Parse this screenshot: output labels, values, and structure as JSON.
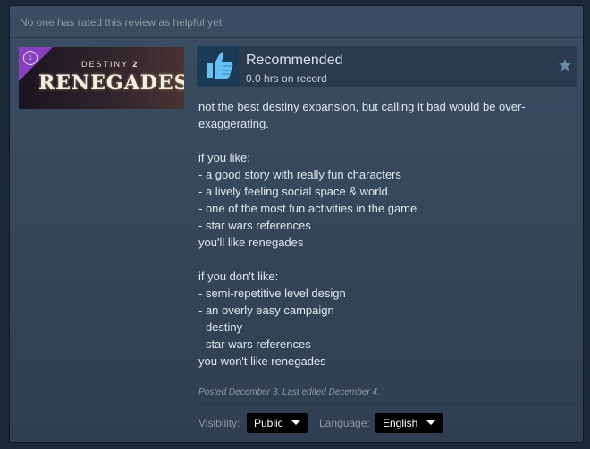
{
  "helpful_text": "No one has rated this review as helpful yet",
  "game": {
    "subtitle_prefix": "DESTINY",
    "subtitle_suffix": "2",
    "title": "RENEGADES",
    "badge_icon": "download-arrow-icon"
  },
  "rating": {
    "label": "Recommended",
    "hours": "0.0 hrs on record",
    "icon": "thumbs-up-icon",
    "award_icon": "star-icon"
  },
  "review": {
    "lines": [
      "not the best destiny expansion, but calling it bad would be over-exaggerating.",
      "",
      "if you like:",
      "- a good story with really fun characters",
      "- a lively feeling social space & world",
      "- one of the most fun activities in the game",
      "- star wars references",
      "you'll like renegades",
      "",
      "if you don't like:",
      "- semi-repetitive level design",
      "- an overly easy campaign",
      "- destiny",
      "- star wars references",
      "you won't like renegades"
    ]
  },
  "posted": "Posted December 3. Last edited December 4.",
  "controls": {
    "visibility_label": "Visibility:",
    "visibility_value": "Public",
    "language_label": "Language:",
    "language_value": "English"
  },
  "colors": {
    "background": "#1b2838",
    "panel": "#3b4d63",
    "accent_blue": "#66c0f4",
    "badge_purple": "#8a3fbf"
  }
}
